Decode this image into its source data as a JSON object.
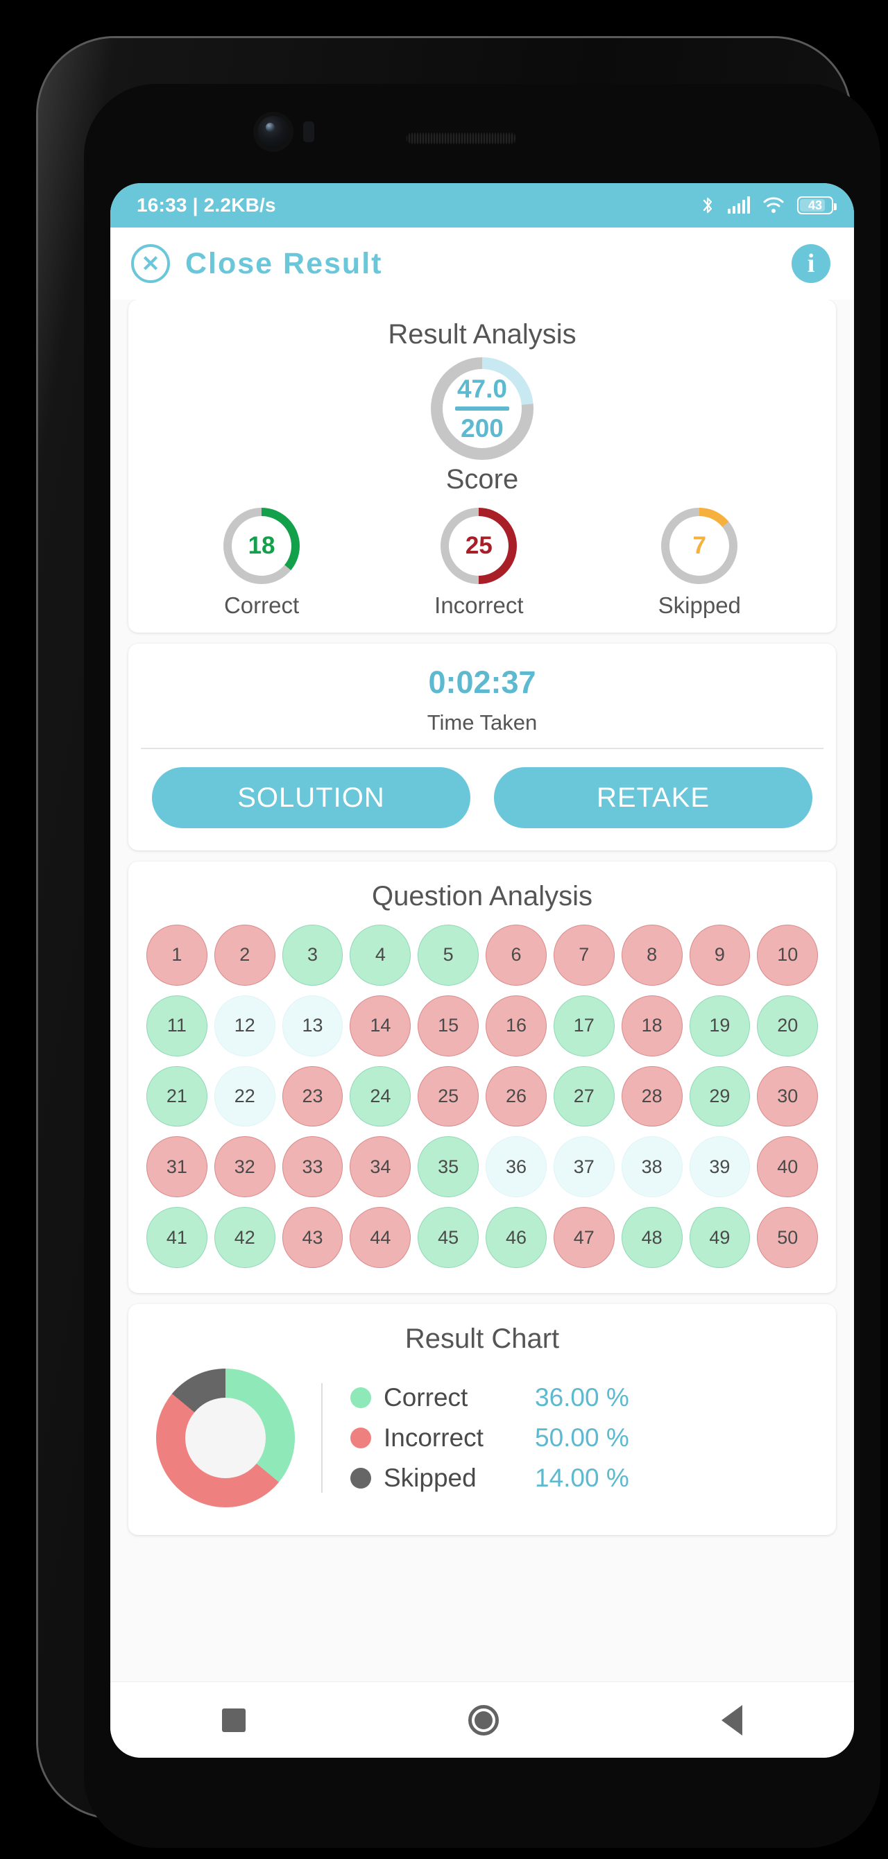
{
  "status_bar": {
    "time": "16:33",
    "separator": "|",
    "network_speed": "2.2KB/s",
    "battery_percent": "43",
    "icons": [
      "bluetooth-icon",
      "signal-icon",
      "wifi-icon",
      "battery-icon"
    ]
  },
  "header": {
    "close_label": "Close Result",
    "close_icon": "close-circle-icon",
    "info_icon": "info-icon"
  },
  "result_analysis": {
    "title": "Result Analysis",
    "score_value": "47.0",
    "score_total": "200",
    "score_label": "Score",
    "score_percent": 23.5,
    "stats": [
      {
        "value": "18",
        "label": "Correct",
        "color": "#12a04a",
        "percent": 36
      },
      {
        "value": "25",
        "label": "Incorrect",
        "color": "#a81f28",
        "percent": 50
      },
      {
        "value": "7",
        "label": "Skipped",
        "color": "#f5b03e",
        "percent": 14
      }
    ]
  },
  "time_card": {
    "time_taken": "0:02:37",
    "time_label": "Time Taken",
    "solution_label": "SOLUTION",
    "retake_label": "RETAKE"
  },
  "question_analysis": {
    "title": "Question Analysis",
    "questions": [
      {
        "n": "1",
        "s": "incorrect"
      },
      {
        "n": "2",
        "s": "incorrect"
      },
      {
        "n": "3",
        "s": "correct"
      },
      {
        "n": "4",
        "s": "correct"
      },
      {
        "n": "5",
        "s": "correct"
      },
      {
        "n": "6",
        "s": "incorrect"
      },
      {
        "n": "7",
        "s": "incorrect"
      },
      {
        "n": "8",
        "s": "incorrect"
      },
      {
        "n": "9",
        "s": "incorrect"
      },
      {
        "n": "10",
        "s": "incorrect"
      },
      {
        "n": "11",
        "s": "correct"
      },
      {
        "n": "12",
        "s": "skipped"
      },
      {
        "n": "13",
        "s": "skipped"
      },
      {
        "n": "14",
        "s": "incorrect"
      },
      {
        "n": "15",
        "s": "incorrect"
      },
      {
        "n": "16",
        "s": "incorrect"
      },
      {
        "n": "17",
        "s": "correct"
      },
      {
        "n": "18",
        "s": "incorrect"
      },
      {
        "n": "19",
        "s": "correct"
      },
      {
        "n": "20",
        "s": "correct"
      },
      {
        "n": "21",
        "s": "correct"
      },
      {
        "n": "22",
        "s": "skipped"
      },
      {
        "n": "23",
        "s": "incorrect"
      },
      {
        "n": "24",
        "s": "correct"
      },
      {
        "n": "25",
        "s": "incorrect"
      },
      {
        "n": "26",
        "s": "incorrect"
      },
      {
        "n": "27",
        "s": "correct"
      },
      {
        "n": "28",
        "s": "incorrect"
      },
      {
        "n": "29",
        "s": "correct"
      },
      {
        "n": "30",
        "s": "incorrect"
      },
      {
        "n": "31",
        "s": "incorrect"
      },
      {
        "n": "32",
        "s": "incorrect"
      },
      {
        "n": "33",
        "s": "incorrect"
      },
      {
        "n": "34",
        "s": "incorrect"
      },
      {
        "n": "35",
        "s": "correct"
      },
      {
        "n": "36",
        "s": "skipped"
      },
      {
        "n": "37",
        "s": "skipped"
      },
      {
        "n": "38",
        "s": "skipped"
      },
      {
        "n": "39",
        "s": "skipped"
      },
      {
        "n": "40",
        "s": "incorrect"
      },
      {
        "n": "41",
        "s": "correct"
      },
      {
        "n": "42",
        "s": "correct"
      },
      {
        "n": "43",
        "s": "incorrect"
      },
      {
        "n": "44",
        "s": "incorrect"
      },
      {
        "n": "45",
        "s": "correct"
      },
      {
        "n": "46",
        "s": "correct"
      },
      {
        "n": "47",
        "s": "incorrect"
      },
      {
        "n": "48",
        "s": "correct"
      },
      {
        "n": "49",
        "s": "correct"
      },
      {
        "n": "50",
        "s": "incorrect"
      }
    ]
  },
  "result_chart": {
    "title": "Result Chart",
    "legend": [
      {
        "name": "Correct",
        "percent": "36.00 %",
        "color": "#8fe8b8"
      },
      {
        "name": "Incorrect",
        "percent": "50.00 %",
        "color": "#ef8080"
      },
      {
        "name": "Skipped",
        "percent": "14.00 %",
        "color": "#666666"
      }
    ]
  },
  "chart_data": {
    "type": "pie",
    "title": "Result Chart",
    "categories": [
      "Correct",
      "Incorrect",
      "Skipped"
    ],
    "values": [
      36.0,
      50.0,
      14.0
    ],
    "value_labels": [
      "36.00 %",
      "50.00 %",
      "14.00 %"
    ],
    "colors": [
      "#8fe8b8",
      "#ef8080",
      "#666666"
    ],
    "donut": true,
    "legend_position": "right",
    "units": "percent"
  },
  "nav_bar": {
    "recents_icon": "square-icon",
    "home_icon": "circle-icon",
    "back_icon": "triangle-left-icon"
  },
  "theme": {
    "accent": "#6ac6d9",
    "correct": "#b8eed0",
    "incorrect": "#f0b3b3",
    "skipped": "#eafafb"
  }
}
